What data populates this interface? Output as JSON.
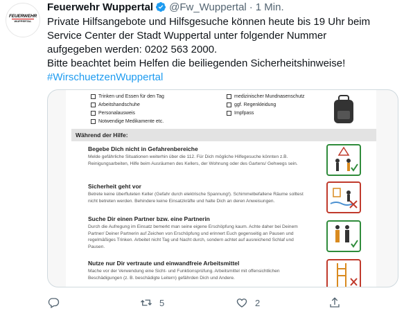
{
  "author": {
    "name": "Feuerwehr Wuppertal",
    "handle": "@Fw_Wuppertal",
    "separator": "·",
    "time": "1 Min.",
    "avatar_logo_line1": "FEUERWEHR",
    "avatar_logo_line2": "WUPPERTAL"
  },
  "tweet": {
    "line1": "Private Hilfsangebote und Hilfsgesuche können heute bis 19 Uhr beim",
    "line2": "Service Center der Stadt Wuppertal unter folgender Nummer",
    "line3": "aufgegeben werden: 0202 563 2000.",
    "line4": "Bitte beachtet beim Helfen die beiliegenden Sicherheitshinweise!",
    "hashtag": "#WirschuetzenWuppertal"
  },
  "document": {
    "checklist_left": [
      "Trinken und Essen für den Tag",
      "Arbeitshandschuhe",
      "Personalausweis",
      "Notwendige Medikamente etc."
    ],
    "checklist_right": [
      "medizinischer Mundnasenschutz",
      "ggf. Regenkleidung",
      "Impfpass"
    ],
    "section_title": "Während der Hilfe:",
    "items": [
      {
        "title": "Begebe Dich nicht in Gefahrenbereiche",
        "text": "Melde gefährliche Situationen weiterhin über die 112. Für Dich mögliche Hilfegesuche könnten z.B. Reinigungsarbeiten, Hilfe beim Ausräumen des Kellers, der Wohnung oder des Gartens/ Gehwegs sein."
      },
      {
        "title": "Sicherheit geht vor",
        "text": "Betrete keine überfluteten Keller (Gefahr durch elektrische Spannung!). Schimmelbefallene Räume solltest nicht betreten werden. Behindere keine Einsatzkräfte und halte Dich an deren Anweisungen."
      },
      {
        "title": "Suche Dir einen Partner bzw. eine Partnerin",
        "text": "Durch die Aufregung im Einsatz bemerkt man seine eigene Erschöpfung kaum. Achte daher bei Deinem Partner/ Deiner Partnerin auf Zeichen von Erschöpfung und erinnert Euch gegenseitig an Pausen und regelmäßiges Trinken. Arbeitet nicht Tag und Nacht durch, sondern achtet auf ausreichend Schlaf und Pausen."
      },
      {
        "title": "Nutze nur Dir vertraute und einwandfreie Arbeitsmittel",
        "text": "Mache vor der Verwendung eine Sicht- und Funktionsprüfung. Arbeitsmittel mit offensichtlichen Beschädigungen (z. B. beschädigte Leitern) gefährden Dich und Andere."
      }
    ]
  },
  "actions": {
    "reply_count": "",
    "retweet_count": "5",
    "like_count": "2"
  },
  "colors": {
    "link": "#1d9bf0",
    "muted": "#536471",
    "verified": "#1d9bf0"
  }
}
